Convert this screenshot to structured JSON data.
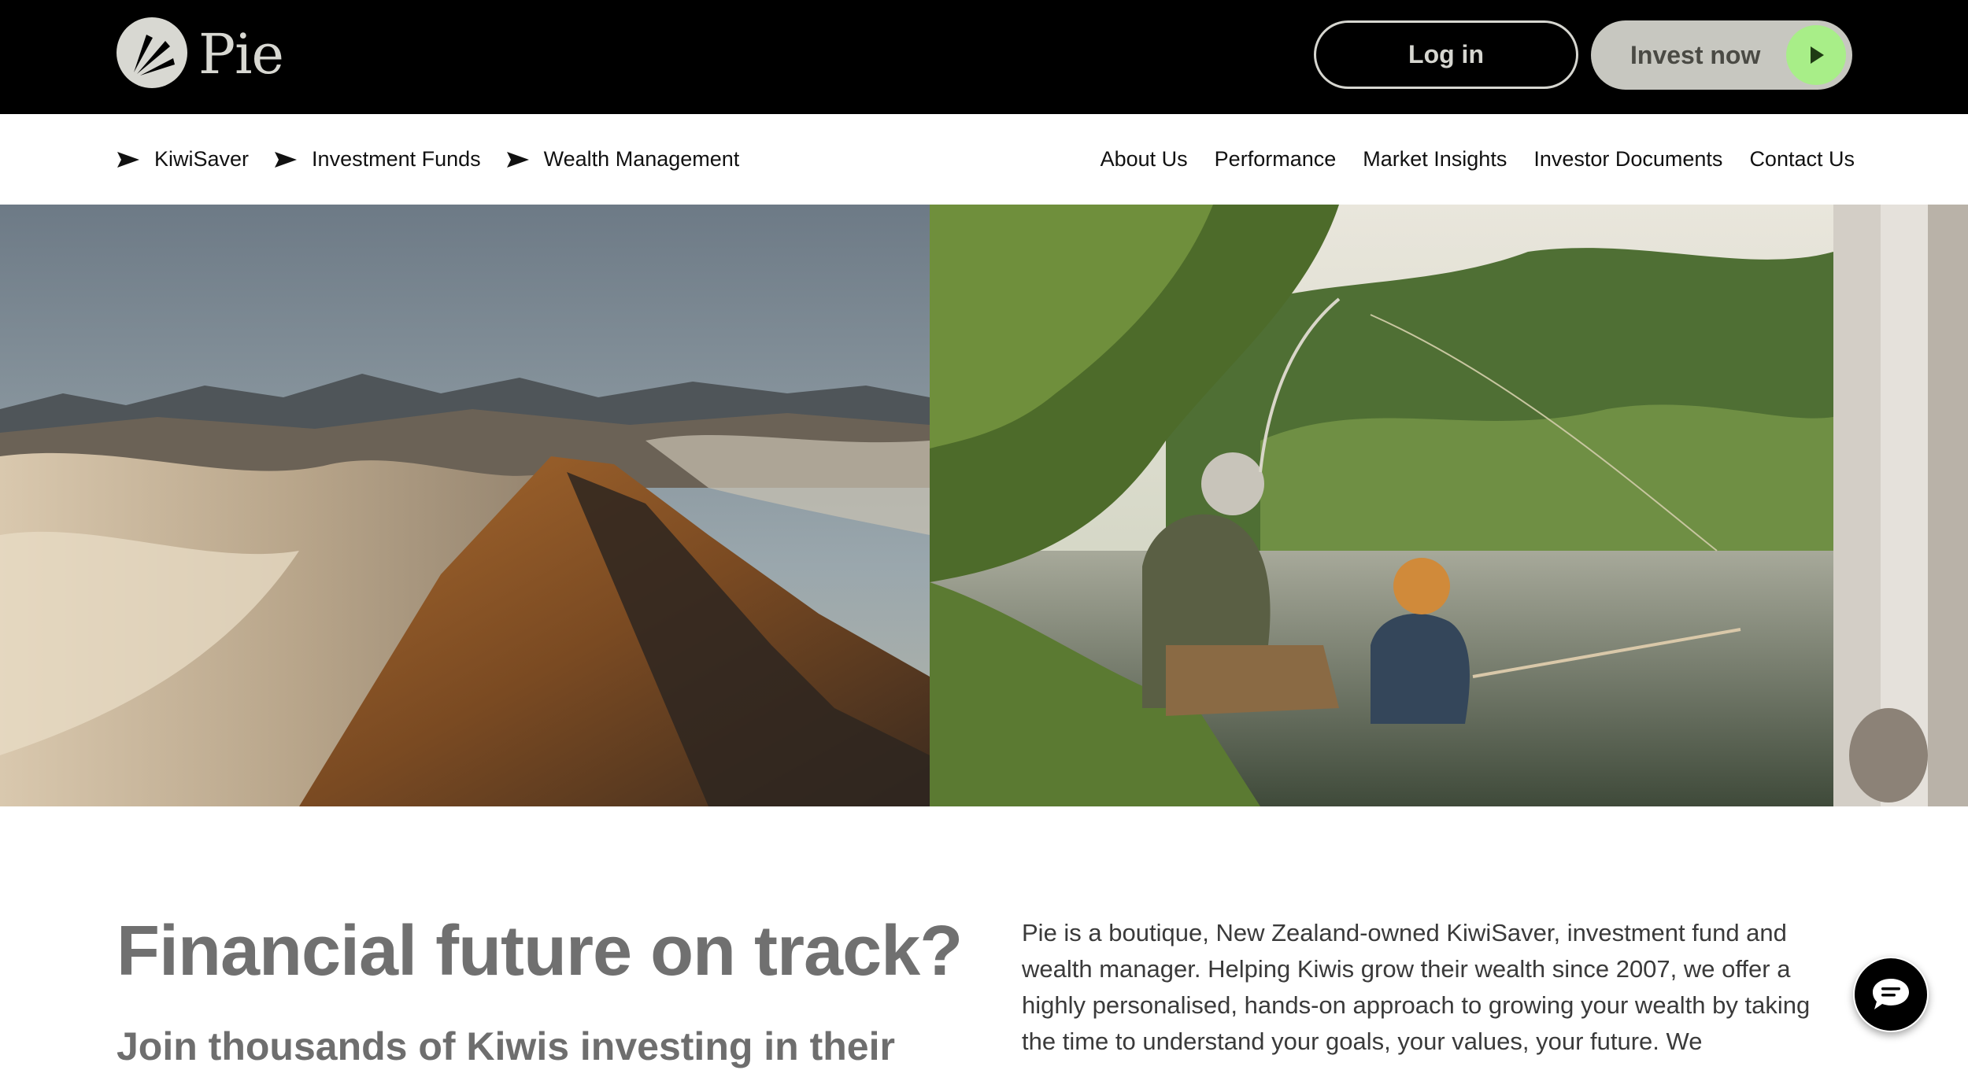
{
  "header": {
    "logo_text": "Pie",
    "login_label": "Log in",
    "invest_label": "Invest now",
    "accent_color": "#a8ee88"
  },
  "nav": {
    "left": [
      {
        "label": "KiwiSaver",
        "icon": "flag-icon"
      },
      {
        "label": "Investment Funds",
        "icon": "flag-icon"
      },
      {
        "label": "Wealth Management",
        "icon": "flag-icon"
      }
    ],
    "right": [
      {
        "label": "About Us"
      },
      {
        "label": "Performance"
      },
      {
        "label": "Market Insights"
      },
      {
        "label": "Investor Documents"
      },
      {
        "label": "Contact Us"
      }
    ]
  },
  "hero": {
    "images": [
      {
        "name": "mountain-image"
      },
      {
        "name": "fishing-image"
      },
      {
        "name": "partial-image"
      }
    ]
  },
  "content": {
    "headline": "Financial future on track?",
    "subheadline": "Join thousands of Kiwis investing in their",
    "intro": "Pie is a boutique, New Zealand-owned KiwiSaver, investment fund and wealth manager. Helping Kiwis grow their wealth since 2007, we offer a highly personalised, hands-on approach to growing your wealth by taking the time to understand your goals, your values, your future. We"
  },
  "chat": {
    "icon": "chat-icon"
  }
}
